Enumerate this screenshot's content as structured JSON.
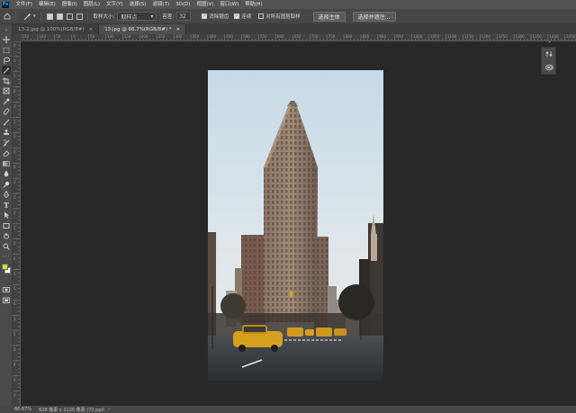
{
  "app": {
    "logo": "Ps"
  },
  "menu": [
    "文件(F)",
    "编辑(E)",
    "图像(I)",
    "图层(L)",
    "文字(Y)",
    "选择(S)",
    "滤镜(T)",
    "3D(D)",
    "视图(V)",
    "窗口(W)",
    "帮助(H)"
  ],
  "options": {
    "tool_icon": "magic-wand-icon",
    "sample_size_label": "取样大小:",
    "sample_size_value": "取样点",
    "tolerance_label": "容差:",
    "tolerance_value": "32",
    "antialias_label": "消除锯齿",
    "antialias_checked": true,
    "contiguous_label": "连续",
    "contiguous_checked": true,
    "all_layers_label": "对所有图层取样",
    "all_layers_checked": false,
    "select_subject": "选择主体",
    "select_and_mask": "选择并遮住..."
  },
  "tabs": [
    {
      "label": "13-2.jpg @ 100%(RGB/8#)",
      "close": "×",
      "active": false
    },
    {
      "label": "13.jpg @ 66.7%(RGB/8#) *",
      "close": "×",
      "active": true
    }
  ],
  "ruler_top": [
    "150",
    "100",
    "50",
    "0",
    "50",
    "100",
    "150",
    "200",
    "250",
    "300",
    "350",
    "400",
    "450",
    "500",
    "550",
    "600",
    "650",
    "700",
    "750",
    "800",
    "850",
    "900",
    "950",
    "1000",
    "1050",
    "1100",
    "1150",
    "1200",
    "1250",
    "1300",
    "1350",
    "1400",
    "1450"
  ],
  "ruler_left": [
    "0",
    "1",
    "5",
    "0",
    "0",
    "1",
    "5",
    "0",
    "0",
    "2",
    "0",
    "0",
    "2",
    "5",
    "0",
    "3",
    "0",
    "0",
    "3",
    "5",
    "0",
    "4",
    "0",
    "0"
  ],
  "tools": [
    "move-icon",
    "marquee-icon",
    "lasso-icon",
    "magic-wand-icon",
    "crop-icon",
    "frame-icon",
    "eyedropper-icon",
    "healing-brush-icon",
    "brush-icon",
    "clone-stamp-icon",
    "history-brush-icon",
    "eraser-icon",
    "gradient-icon",
    "blur-icon",
    "dodge-icon",
    "pen-icon",
    "type-icon",
    "path-select-icon",
    "rectangle-icon",
    "hand-icon",
    "zoom-icon",
    "more-tools-icon",
    "color-swatch-icon",
    "quick-mask-icon",
    "screen-mode-icon"
  ],
  "colors": {
    "foreground": "#c8e62a",
    "background": "#ffffff"
  },
  "panels": {
    "icons": [
      "properties-icon",
      "adjustments-icon"
    ],
    "collapse": "»"
  },
  "status": {
    "zoom": "66.67%",
    "doc_size": "638 像素 x 1120 像素 (72 ppi)"
  }
}
